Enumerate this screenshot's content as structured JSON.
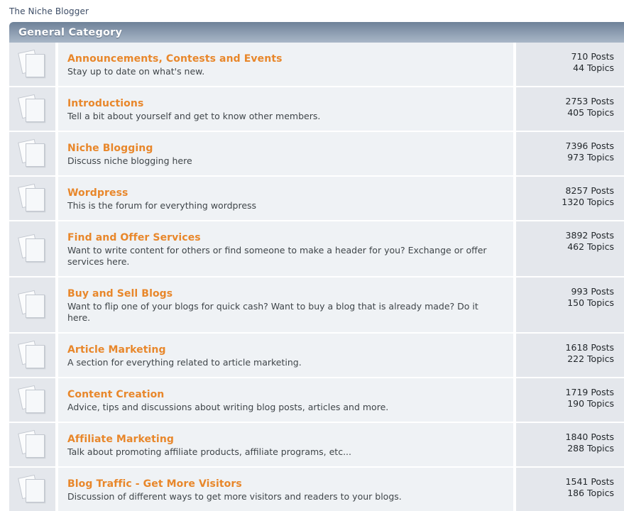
{
  "breadcrumb": {
    "items": [
      "The Niche Blogger"
    ]
  },
  "category": {
    "title": "General Category"
  },
  "labels": {
    "posts_suffix": "Posts",
    "topics_suffix": "Topics"
  },
  "colors": {
    "title_link": "#e8872b",
    "header_gradient_top": "#6e8198",
    "header_gradient_bottom": "#a9b7c7",
    "icon_cell_bg": "#e4e7ec",
    "info_cell_bg": "#eff2f5",
    "breadcrumb_text": "#3d4d66"
  },
  "icons": {
    "folder": "folder-pages-icon"
  },
  "forums": [
    {
      "title": "Announcements, Contests and Events",
      "description": "Stay up to date on what's new.",
      "posts": "710 Posts",
      "topics": "44 Topics"
    },
    {
      "title": "Introductions",
      "description": "Tell a bit about yourself and get to know other members.",
      "posts": "2753 Posts",
      "topics": "405 Topics"
    },
    {
      "title": "Niche Blogging",
      "description": "Discuss niche blogging here",
      "posts": "7396 Posts",
      "topics": "973 Topics"
    },
    {
      "title": "Wordpress",
      "description": "This is the forum for everything wordpress",
      "posts": "8257 Posts",
      "topics": "1320 Topics"
    },
    {
      "title": "Find and Offer Services",
      "description": "Want to write content for others or find someone to make a header for you? Exchange or offer services here.",
      "posts": "3892 Posts",
      "topics": "462 Topics"
    },
    {
      "title": "Buy and Sell Blogs",
      "description": "Want to flip one of your blogs for quick cash? Want to buy a blog that is already made? Do it here.",
      "posts": "993 Posts",
      "topics": "150 Topics"
    },
    {
      "title": "Article Marketing",
      "description": "A section for everything related to article marketing.",
      "posts": "1618 Posts",
      "topics": "222 Topics"
    },
    {
      "title": "Content Creation",
      "description": "Advice, tips and discussions about writing blog posts, articles and more.",
      "posts": "1719 Posts",
      "topics": "190 Topics"
    },
    {
      "title": "Affiliate Marketing",
      "description": "Talk about promoting affiliate products, affiliate programs, etc...",
      "posts": "1840 Posts",
      "topics": "288 Topics"
    },
    {
      "title": "Blog Traffic - Get More Visitors",
      "description": "Discussion of different ways to get more visitors and readers to your blogs.",
      "posts": "1541 Posts",
      "topics": "186 Topics"
    }
  ]
}
